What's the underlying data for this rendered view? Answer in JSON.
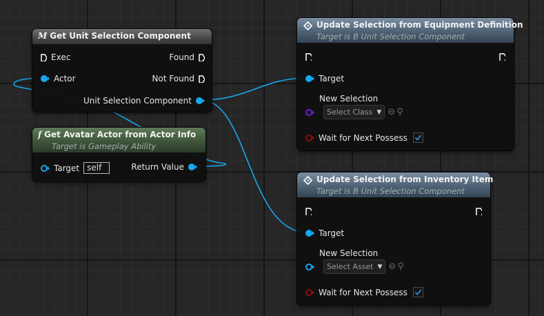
{
  "nodes": {
    "get_unit_selection": {
      "icon": "M",
      "title": "Get Unit Selection Component",
      "pins": {
        "exec": "Exec",
        "found": "Found",
        "actor": "Actor",
        "not_found": "Not Found",
        "unit_selection": "Unit Selection Component"
      }
    },
    "get_avatar": {
      "icon": "f",
      "title": "Get Avatar Actor from Actor Info",
      "subtitle": "Target is Gameplay Ability",
      "pins": {
        "target": "Target",
        "target_value": "self",
        "return_value": "Return Value"
      }
    },
    "update_from_equipment": {
      "title": "Update Selection from Equipment Definition",
      "subtitle": "Target is B Unit Selection Component",
      "pins": {
        "target": "Target",
        "new_selection": "New Selection",
        "select_placeholder": "Select Class",
        "wait": "Wait for Next Possess"
      },
      "wait_checked": true
    },
    "update_from_inventory": {
      "title": "Update Selection from Inventory Item",
      "subtitle": "Target is B Unit Selection Component",
      "pins": {
        "target": "Target",
        "new_selection": "New Selection",
        "select_placeholder": "Select Asset",
        "wait": "Wait for Next Possess"
      },
      "wait_checked": true
    }
  },
  "colors": {
    "object_pin": "#17a7ee",
    "class_pin": "#6d1fd1",
    "bool_pin": "#8a0d0d",
    "exec_pin": "#ffffff",
    "checkbox_tick": "#2a8fd6"
  },
  "icons": [
    "macro-icon",
    "function-icon",
    "event-node-icon",
    "exec-pin-icon",
    "chevron-down-icon",
    "use-selected-icon",
    "browse-icon",
    "checkmark-icon"
  ]
}
